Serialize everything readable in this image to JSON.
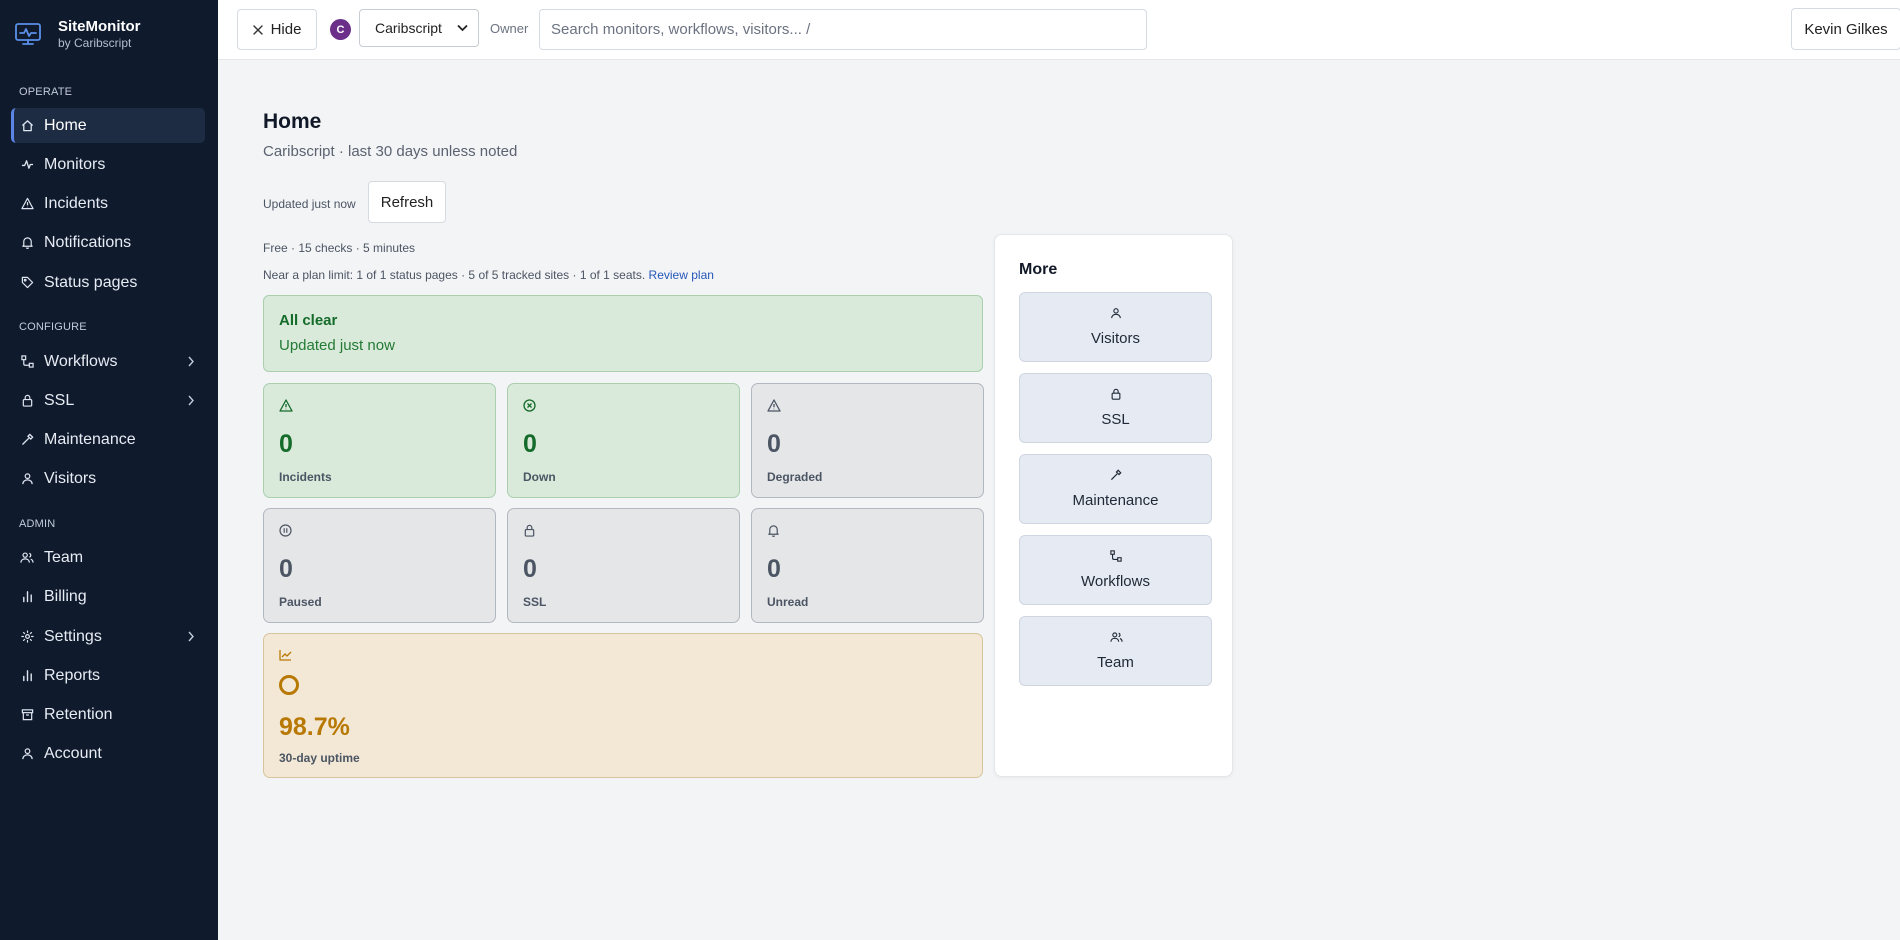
{
  "app": {
    "name": "SiteMonitor",
    "byline": "by Caribscript"
  },
  "sidebar": {
    "sections": [
      {
        "label": "OPERATE",
        "items": [
          {
            "label": "Home",
            "icon": "home-icon",
            "active": true
          },
          {
            "label": "Monitors",
            "icon": "activity-icon"
          },
          {
            "label": "Incidents",
            "icon": "alert-triangle-icon"
          },
          {
            "label": "Notifications",
            "icon": "bell-icon"
          },
          {
            "label": "Status pages",
            "icon": "tag-icon"
          }
        ]
      },
      {
        "label": "CONFIGURE",
        "items": [
          {
            "label": "Workflows",
            "icon": "workflow-icon",
            "expandable": true
          },
          {
            "label": "SSL",
            "icon": "lock-icon",
            "expandable": true
          },
          {
            "label": "Maintenance",
            "icon": "hammer-icon"
          },
          {
            "label": "Visitors",
            "icon": "user-icon"
          }
        ]
      },
      {
        "label": "ADMIN",
        "items": [
          {
            "label": "Team",
            "icon": "users-icon"
          },
          {
            "label": "Billing",
            "icon": "bar-chart-icon"
          },
          {
            "label": "Settings",
            "icon": "gear-icon",
            "expandable": true
          },
          {
            "label": "Reports",
            "icon": "bar-chart-icon"
          },
          {
            "label": "Retention",
            "icon": "archive-icon"
          },
          {
            "label": "Account",
            "icon": "user-icon"
          }
        ]
      }
    ]
  },
  "topbar": {
    "hide_label": "Hide",
    "org_initial": "C",
    "org_name": "Caribscript",
    "owner_label": "Owner",
    "search_placeholder": "Search monitors, workflows, visitors...  /",
    "user_name": "Kevin Gilkes"
  },
  "main": {
    "title": "Home",
    "subtitle": "Caribscript · last 30 days unless noted",
    "updated": "Updated just now",
    "refresh_label": "Refresh",
    "plan": "Free · 15 checks · 5 minutes",
    "plan_limit": "Near a plan limit: 1 of 1 status pages · 5 of 5 tracked sites · 1 of 1 seats.",
    "plan_link": "Review plan",
    "banner": {
      "title": "All clear",
      "subtitle": "Updated just now"
    },
    "stats": [
      {
        "value": "0",
        "label": "Incidents",
        "icon": "alert-triangle-icon",
        "tone": "green"
      },
      {
        "value": "0",
        "label": "Down",
        "icon": "x-circle-icon",
        "tone": "green"
      },
      {
        "value": "0",
        "label": "Degraded",
        "icon": "alert-triangle-icon",
        "tone": "gray"
      },
      {
        "value": "0",
        "label": "Paused",
        "icon": "pause-circle-icon",
        "tone": "gray"
      },
      {
        "value": "0",
        "label": "SSL",
        "icon": "lock-icon",
        "tone": "gray"
      },
      {
        "value": "0",
        "label": "Unread",
        "icon": "bell-icon",
        "tone": "gray"
      }
    ],
    "uptime": {
      "value": "98.7%",
      "label": "30-day uptime",
      "icon": "line-chart-icon"
    }
  },
  "more": {
    "title": "More",
    "items": [
      {
        "label": "Visitors",
        "icon": "user-icon"
      },
      {
        "label": "SSL",
        "icon": "lock-icon"
      },
      {
        "label": "Maintenance",
        "icon": "hammer-icon"
      },
      {
        "label": "Workflows",
        "icon": "workflow-icon"
      },
      {
        "label": "Team",
        "icon": "users-icon"
      }
    ]
  },
  "colors": {
    "sidebar_bg": "#0f1a2c",
    "accent": "#5b86e5",
    "success": "#146b2a",
    "warning": "#b87904"
  }
}
